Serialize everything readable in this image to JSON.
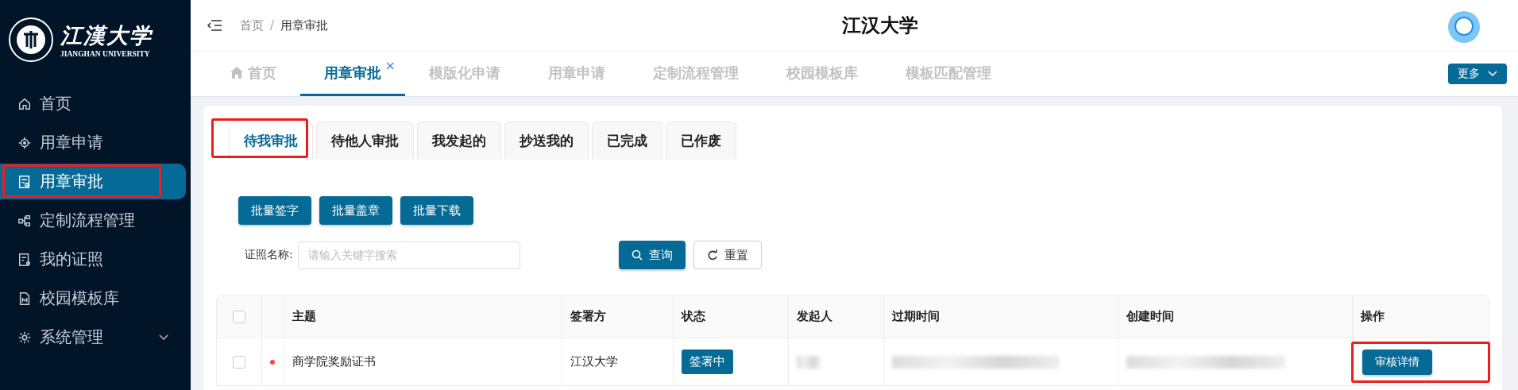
{
  "sidebar": {
    "logo_text": "江漢大学",
    "logo_subtitle": "JIANGHAN UNIVERSITY",
    "items": [
      {
        "label": "首页",
        "selected": false,
        "highlighted": false,
        "expandable": false
      },
      {
        "label": "用章申请",
        "selected": false,
        "highlighted": false,
        "expandable": false
      },
      {
        "label": "用章审批",
        "selected": true,
        "highlighted": true,
        "expandable": false
      },
      {
        "label": "定制流程管理",
        "selected": false,
        "highlighted": false,
        "expandable": false
      },
      {
        "label": "我的证照",
        "selected": false,
        "highlighted": false,
        "expandable": false
      },
      {
        "label": "校园模板库",
        "selected": false,
        "highlighted": false,
        "expandable": false
      },
      {
        "label": "系统管理",
        "selected": false,
        "highlighted": false,
        "expandable": true
      }
    ]
  },
  "header": {
    "breadcrumb": [
      "首页",
      "用章审批"
    ],
    "breadcrumb_separator": "/",
    "title": "江汉大学"
  },
  "page_tabs": {
    "items": [
      {
        "label": "首页",
        "selected": false,
        "closable": false,
        "home": true
      },
      {
        "label": "用章审批",
        "selected": true,
        "closable": true,
        "home": false
      },
      {
        "label": "模版化申请",
        "selected": false,
        "closable": false,
        "home": false
      },
      {
        "label": "用章申请",
        "selected": false,
        "closable": false,
        "home": false
      },
      {
        "label": "定制流程管理",
        "selected": false,
        "closable": false,
        "home": false
      },
      {
        "label": "校园模板库",
        "selected": false,
        "closable": false,
        "home": false
      },
      {
        "label": "模板匹配管理",
        "selected": false,
        "closable": false,
        "home": false
      }
    ],
    "close_glyph": "×",
    "more": "更多"
  },
  "sub_tabs": [
    {
      "label": "待我审批",
      "selected": true,
      "highlighted": true
    },
    {
      "label": "待他人审批",
      "selected": false,
      "highlighted": false
    },
    {
      "label": "我发起的",
      "selected": false,
      "highlighted": false
    },
    {
      "label": "抄送我的",
      "selected": false,
      "highlighted": false
    },
    {
      "label": "已完成",
      "selected": false,
      "highlighted": false
    },
    {
      "label": "已作废",
      "selected": false,
      "highlighted": false
    }
  ],
  "batch_buttons": [
    "批量签字",
    "批量盖章",
    "批量下载"
  ],
  "search": {
    "label": "证照名称:",
    "placeholder": "请输入关键字搜索",
    "query": "查询",
    "reset": "重置"
  },
  "table": {
    "select_all_checked": false,
    "columns": [
      "主题",
      "签署方",
      "状态",
      "发起人",
      "过期时间",
      "创建时间",
      "操作"
    ],
    "rows": [
      {
        "checked": false,
        "unread": true,
        "subject": "商学院奖励证书",
        "signer": "江汉大学",
        "status": "签署中",
        "action": "审核详情",
        "action_highlighted": true
      }
    ]
  }
}
